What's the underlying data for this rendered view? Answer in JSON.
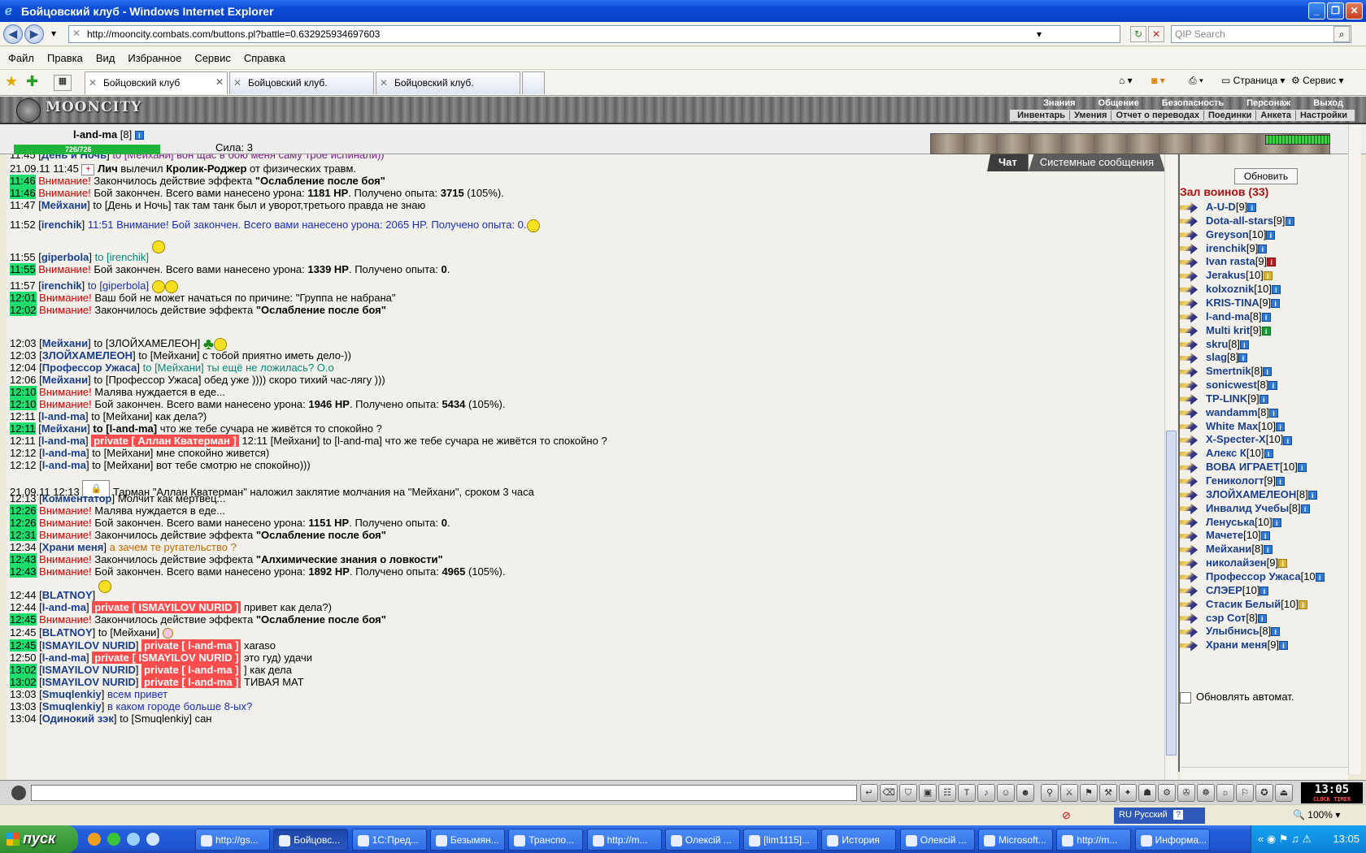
{
  "window": {
    "title": "Бойцовский клуб - Windows Internet Explorer",
    "url": "http://mooncity.combats.com/buttons.pl?battle=0.632925934697603",
    "search_placeholder": "QIP Search"
  },
  "menu": [
    "Файл",
    "Правка",
    "Вид",
    "Избранное",
    "Сервис",
    "Справка"
  ],
  "tabs": [
    "Бойцовский клуб",
    "Бойцовский клуб.",
    "Бойцовский клуб."
  ],
  "toolbar_right": {
    "page": "Страница",
    "service": "Сервис"
  },
  "game": {
    "logo": "MOONCITY",
    "nav": [
      "Знания",
      "Общение",
      "Безопасность",
      "Персонаж",
      "Выход"
    ],
    "subnav": [
      "Инвентарь",
      "Умения",
      "Отчет о переводах",
      "Поединки",
      "Анкета",
      "Настройки"
    ],
    "player": {
      "name": "l-and-ma",
      "level": "[8]",
      "hp": "726/726",
      "hp_fraction": 1.0,
      "strength": "Сила: 3"
    }
  },
  "chat_tabs": [
    "Чат",
    "Системные сообщения"
  ],
  "chat": {
    "l1": {
      "time": "11:45",
      "nick": "День и Ночь",
      "text": "to [Мейхани] вон щас в бою меня саму трое испинали))"
    },
    "l2": {
      "time": "21.09.11 11:45",
      "a": "Лич",
      "mid": " вылечил ",
      "b": "Кролик-Роджер",
      "text": " от физических травм."
    },
    "l3": {
      "time": "11:46",
      "warn": "Внимание!",
      "pre": " Закончилось действие эффекта ",
      "bold": "\"Ослабление после боя\""
    },
    "l4": {
      "time": "11:46",
      "warn": "Внимание!",
      "pre": " Бой закончен. Всего вами нанесено урона: ",
      "b1": "1181 HP",
      "mid": ". Получено опыта: ",
      "b2": "3715",
      "post": " (105%)."
    },
    "l5": {
      "time": "11:47",
      "nick": "Мейхани",
      "text": "to [День и Ночь] так там танк был и уворот,третього правда не знаю"
    },
    "l6": {
      "time": "11:52",
      "nick": "irenchik",
      "text": "11:51 Внимание! Бой закончен. Всего вами нанесено урона: 2065 HP. Получено опыта: 0."
    },
    "l7": {
      "time": "11:55",
      "nick": "giperbola",
      "text": "to [irenchik]"
    },
    "l8": {
      "time": "11:55",
      "warn": "Внимание!",
      "pre": " Бой закончен. Всего вами нанесено урона: ",
      "b1": "1339 HP",
      "mid": ". Получено опыта: ",
      "b2": "0",
      "post": "."
    },
    "l9": {
      "time": "11:57",
      "nick": "irenchik",
      "text": "to [giperbola]"
    },
    "l10": {
      "time": "12:01",
      "warn": "Внимание!",
      "text": " Ваш бой не может начаться по причине: \"Группа не набрана\""
    },
    "l11": {
      "time": "12:02",
      "warn": "Внимание!",
      "pre": " Закончилось действие эффекта ",
      "bold": "\"Ослабление после боя\""
    },
    "l12": {
      "time": "12:03",
      "nick": "Мейхани",
      "text": "to [ЗЛОЙХАМЕЛЕОН]"
    },
    "l13": {
      "time": "12:03",
      "nick": "ЗЛОЙХАМЕЛЕОН",
      "text": "to [Мейхани] с тобой приятно иметь дело-))"
    },
    "l14": {
      "time": "12:04",
      "nick": "Профессор Ужаса",
      "text": "to [Мейхани] ты ещё не ложилась? О.о"
    },
    "l15": {
      "time": "12:06",
      "nick": "Мейхани",
      "text": "to [Профессор Ужаса] обед уже )))) скоро тихий час-лягу )))"
    },
    "l16": {
      "time": "12:10",
      "warn": "Внимание!",
      "text": " Малява нуждается в еде..."
    },
    "l17": {
      "time": "12:10",
      "warn": "Внимание!",
      "pre": " Бой закончен. Всего вами нанесено урона: ",
      "b1": "1946 HP",
      "mid": ". Получено опыта: ",
      "b2": "5434",
      "post": " (105%)."
    },
    "l18": {
      "time": "12:11",
      "nick": "l-and-ma",
      "text": "to [Мейхани] как дела?)"
    },
    "l19": {
      "time": "12:11",
      "nick": "Мейхани",
      "bold": "to [l-and-ma]",
      "text": " что же тебе сучара не живётся то спокойно ?"
    },
    "l20": {
      "time": "12:11",
      "nick": "l-and-ma",
      "pvt": "private [ Аллан Кватерман ]",
      "text": " 12:11 [Мейхани] to [l-and-ma] что же тебе сучара не живётся то спокойно ?"
    },
    "l21": {
      "time": "12:12",
      "nick": "l-and-ma",
      "text": "to [Мейхани] мне спокойно живется)"
    },
    "l22": {
      "time": "12:12",
      "nick": "l-and-ma",
      "text": "to [Мейхани] вот тебе смотрю не спокойно)))"
    },
    "l23": {
      "time": "21.09.11 12:13",
      "text": "Тарман \"Аллан Кватерман\" наложил заклятие молчания на \"Мейхани\", сроком 3 часа"
    },
    "l24": {
      "time": "12:13",
      "nick": "Комментатор",
      "text": "Молчит как мертвец..."
    },
    "l25": {
      "time": "12:26",
      "warn": "Внимание!",
      "text": " Малява нуждается в еде..."
    },
    "l26": {
      "time": "12:26",
      "warn": "Внимание!",
      "pre": " Бой закончен. Всего вами нанесено урона: ",
      "b1": "1151 HP",
      "mid": ". Получено опыта: ",
      "b2": "0",
      "post": "."
    },
    "l27": {
      "time": "12:31",
      "warn": "Внимание!",
      "pre": " Закончилось действие эффекта ",
      "bold": "\"Ослабление после боя\""
    },
    "l28": {
      "time": "12:34",
      "nick": "Храни меня",
      "text": "а зачем те ругательство ?"
    },
    "l29": {
      "time": "12:43",
      "warn": "Внимание!",
      "pre": " Закончилось действие эффекта ",
      "bold": "\"Алхимические знания о ловкости\""
    },
    "l30": {
      "time": "12:43",
      "warn": "Внимание!",
      "pre": " Бой закончен. Всего вами нанесено урона: ",
      "b1": "1892 HP",
      "mid": ". Получено опыта: ",
      "b2": "4965",
      "post": " (105%)."
    },
    "l31": {
      "time": "12:44",
      "nick": "BLATNOY"
    },
    "l32": {
      "time": "12:44",
      "nick": "l-and-ma",
      "pvt": "private [ ISMAYILOV NURID ]",
      "text": " привет как дела?)"
    },
    "l33": {
      "time": "12:45",
      "warn": "Внимание!",
      "pre": " Закончилось действие эффекта ",
      "bold": "\"Ослабление после боя\""
    },
    "l34": {
      "time": "12:45",
      "nick": "BLATNOY",
      "text": "to [Мейхани]"
    },
    "l35": {
      "time": "12:45",
      "nick": "ISMAYILOV NURID",
      "pvt": "private [ l-and-ma ]",
      "text": " xaraso"
    },
    "l36": {
      "time": "12:50",
      "nick": "l-and-ma",
      "pvt": "private [ ISMAYILOV NURID ]",
      "text": " это гуд) удачи"
    },
    "l37": {
      "time": "13:02",
      "nick": "ISMAYILOV NURID",
      "pvt": "private [ l-and-ma ]",
      "text": " ] как дела"
    },
    "l38": {
      "time": "13:02",
      "nick": "ISMAYILOV NURID",
      "pvt": "private [ l-and-ma ]",
      "text": " ТИВАЯ МАТ"
    },
    "l39": {
      "time": "13:03",
      "nick": "Smuqlenkiy",
      "text": "всем привет"
    },
    "l40": {
      "time": "13:03",
      "nick": "Smuqlenkiy",
      "text": "в каком городе больше 8-ых?"
    },
    "l41": {
      "time": "13:04",
      "nick": "Одинокий зэк",
      "text": "to [Smuqlenkiy] сан"
    }
  },
  "room": {
    "refresh": "Обновить",
    "title": "Зал воинов (33)",
    "auto_refresh": "Обновлять автомат.",
    "users": [
      {
        "name": "A-U-D",
        "lvl": "[9]"
      },
      {
        "name": "Dota-all-stars",
        "lvl": "[9]"
      },
      {
        "name": "Greyson",
        "lvl": "[10]"
      },
      {
        "name": "irenchik",
        "lvl": "[9]"
      },
      {
        "name": "Ivan rasta",
        "lvl": "[9]"
      },
      {
        "name": "Jerakus",
        "lvl": "[10]"
      },
      {
        "name": "kolxoznik",
        "lvl": "[10]"
      },
      {
        "name": "KRIS-TINA",
        "lvl": "[9]"
      },
      {
        "name": "l-and-ma",
        "lvl": "[8]"
      },
      {
        "name": "Multi krit",
        "lvl": "[9]"
      },
      {
        "name": "skru",
        "lvl": "[8]"
      },
      {
        "name": "slag",
        "lvl": "[8]"
      },
      {
        "name": "Smertnik",
        "lvl": "[8]"
      },
      {
        "name": "sonicwest",
        "lvl": "[8]"
      },
      {
        "name": "TP-LINK",
        "lvl": "[9]"
      },
      {
        "name": "wandamm",
        "lvl": "[8]"
      },
      {
        "name": "White Max",
        "lvl": "[10]"
      },
      {
        "name": "X-Specter-X",
        "lvl": "[10]"
      },
      {
        "name": "Алекс К",
        "lvl": "[10]"
      },
      {
        "name": "ВОВА ИГРАЕТ",
        "lvl": "[10]"
      },
      {
        "name": "Геникологт",
        "lvl": "[9]"
      },
      {
        "name": "ЗЛОЙХАМЕЛЕОН",
        "lvl": "[8]"
      },
      {
        "name": "Инвалид Учебы",
        "lvl": "[8]"
      },
      {
        "name": "Ленуська",
        "lvl": "[10]"
      },
      {
        "name": "Мачете",
        "lvl": "[10]"
      },
      {
        "name": "Мейхани",
        "lvl": "[8]"
      },
      {
        "name": "николайзен",
        "lvl": "[9]"
      },
      {
        "name": "Профессор Ужаса",
        "lvl": "[10"
      },
      {
        "name": "СЛЭЕР",
        "lvl": "[10]"
      },
      {
        "name": "Стасик Белый",
        "lvl": "[10]"
      },
      {
        "name": "сэр Сот",
        "lvl": "[8]"
      },
      {
        "name": "Улыбнись",
        "lvl": "[8]"
      },
      {
        "name": "Храни меня",
        "lvl": "[9]"
      }
    ]
  },
  "clock": {
    "time": "13:05",
    "label": "CLOCK TIMER"
  },
  "statusbar": {
    "lang": "RU Русский",
    "zoom": "100%"
  },
  "taskbar": {
    "start": "пуск",
    "tasks": [
      "http://gs...",
      "Бойцовс...",
      "1С:Пред...",
      "Безымян...",
      "Транспо...",
      "http://m...",
      "Олексій ...",
      "[lim1115]...",
      "История",
      "Олексій ...",
      "Microsoft...",
      "http://m...",
      "Информа..."
    ],
    "time": "13:05"
  }
}
